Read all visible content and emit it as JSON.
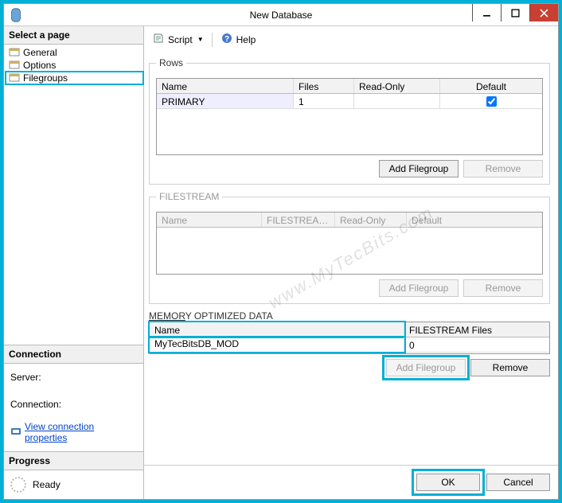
{
  "window": {
    "title": "New Database"
  },
  "sidebar": {
    "select_page_label": "Select a page",
    "pages": [
      "General",
      "Options",
      "Filegroups"
    ],
    "connection_label": "Connection",
    "server_label": "Server:",
    "connection_field_label": "Connection:",
    "view_connection_link": "View connection properties",
    "progress_label": "Progress",
    "progress_status": "Ready"
  },
  "toolbar": {
    "script_label": "Script",
    "help_label": "Help"
  },
  "rows_group": {
    "legend": "Rows",
    "headers": [
      "Name",
      "Files",
      "Read-Only",
      "Default"
    ],
    "row": {
      "name": "PRIMARY",
      "files": "1",
      "readonly": "",
      "default_checked": true
    },
    "add_label": "Add Filegroup",
    "remove_label": "Remove"
  },
  "filestream_group": {
    "legend": "FILESTREAM",
    "headers": [
      "Name",
      "FILESTREAM...",
      "Read-Only",
      "Default"
    ],
    "add_label": "Add Filegroup",
    "remove_label": "Remove"
  },
  "memory_group": {
    "legend": "MEMORY OPTIMIZED DATA",
    "headers": [
      "Name",
      "FILESTREAM Files"
    ],
    "row": {
      "name": "MyTecBitsDB_MOD",
      "files": "0"
    },
    "add_label": "Add Filegroup",
    "remove_label": "Remove"
  },
  "footer": {
    "ok_label": "OK",
    "cancel_label": "Cancel"
  },
  "watermark": "www.MyTecBits.com"
}
